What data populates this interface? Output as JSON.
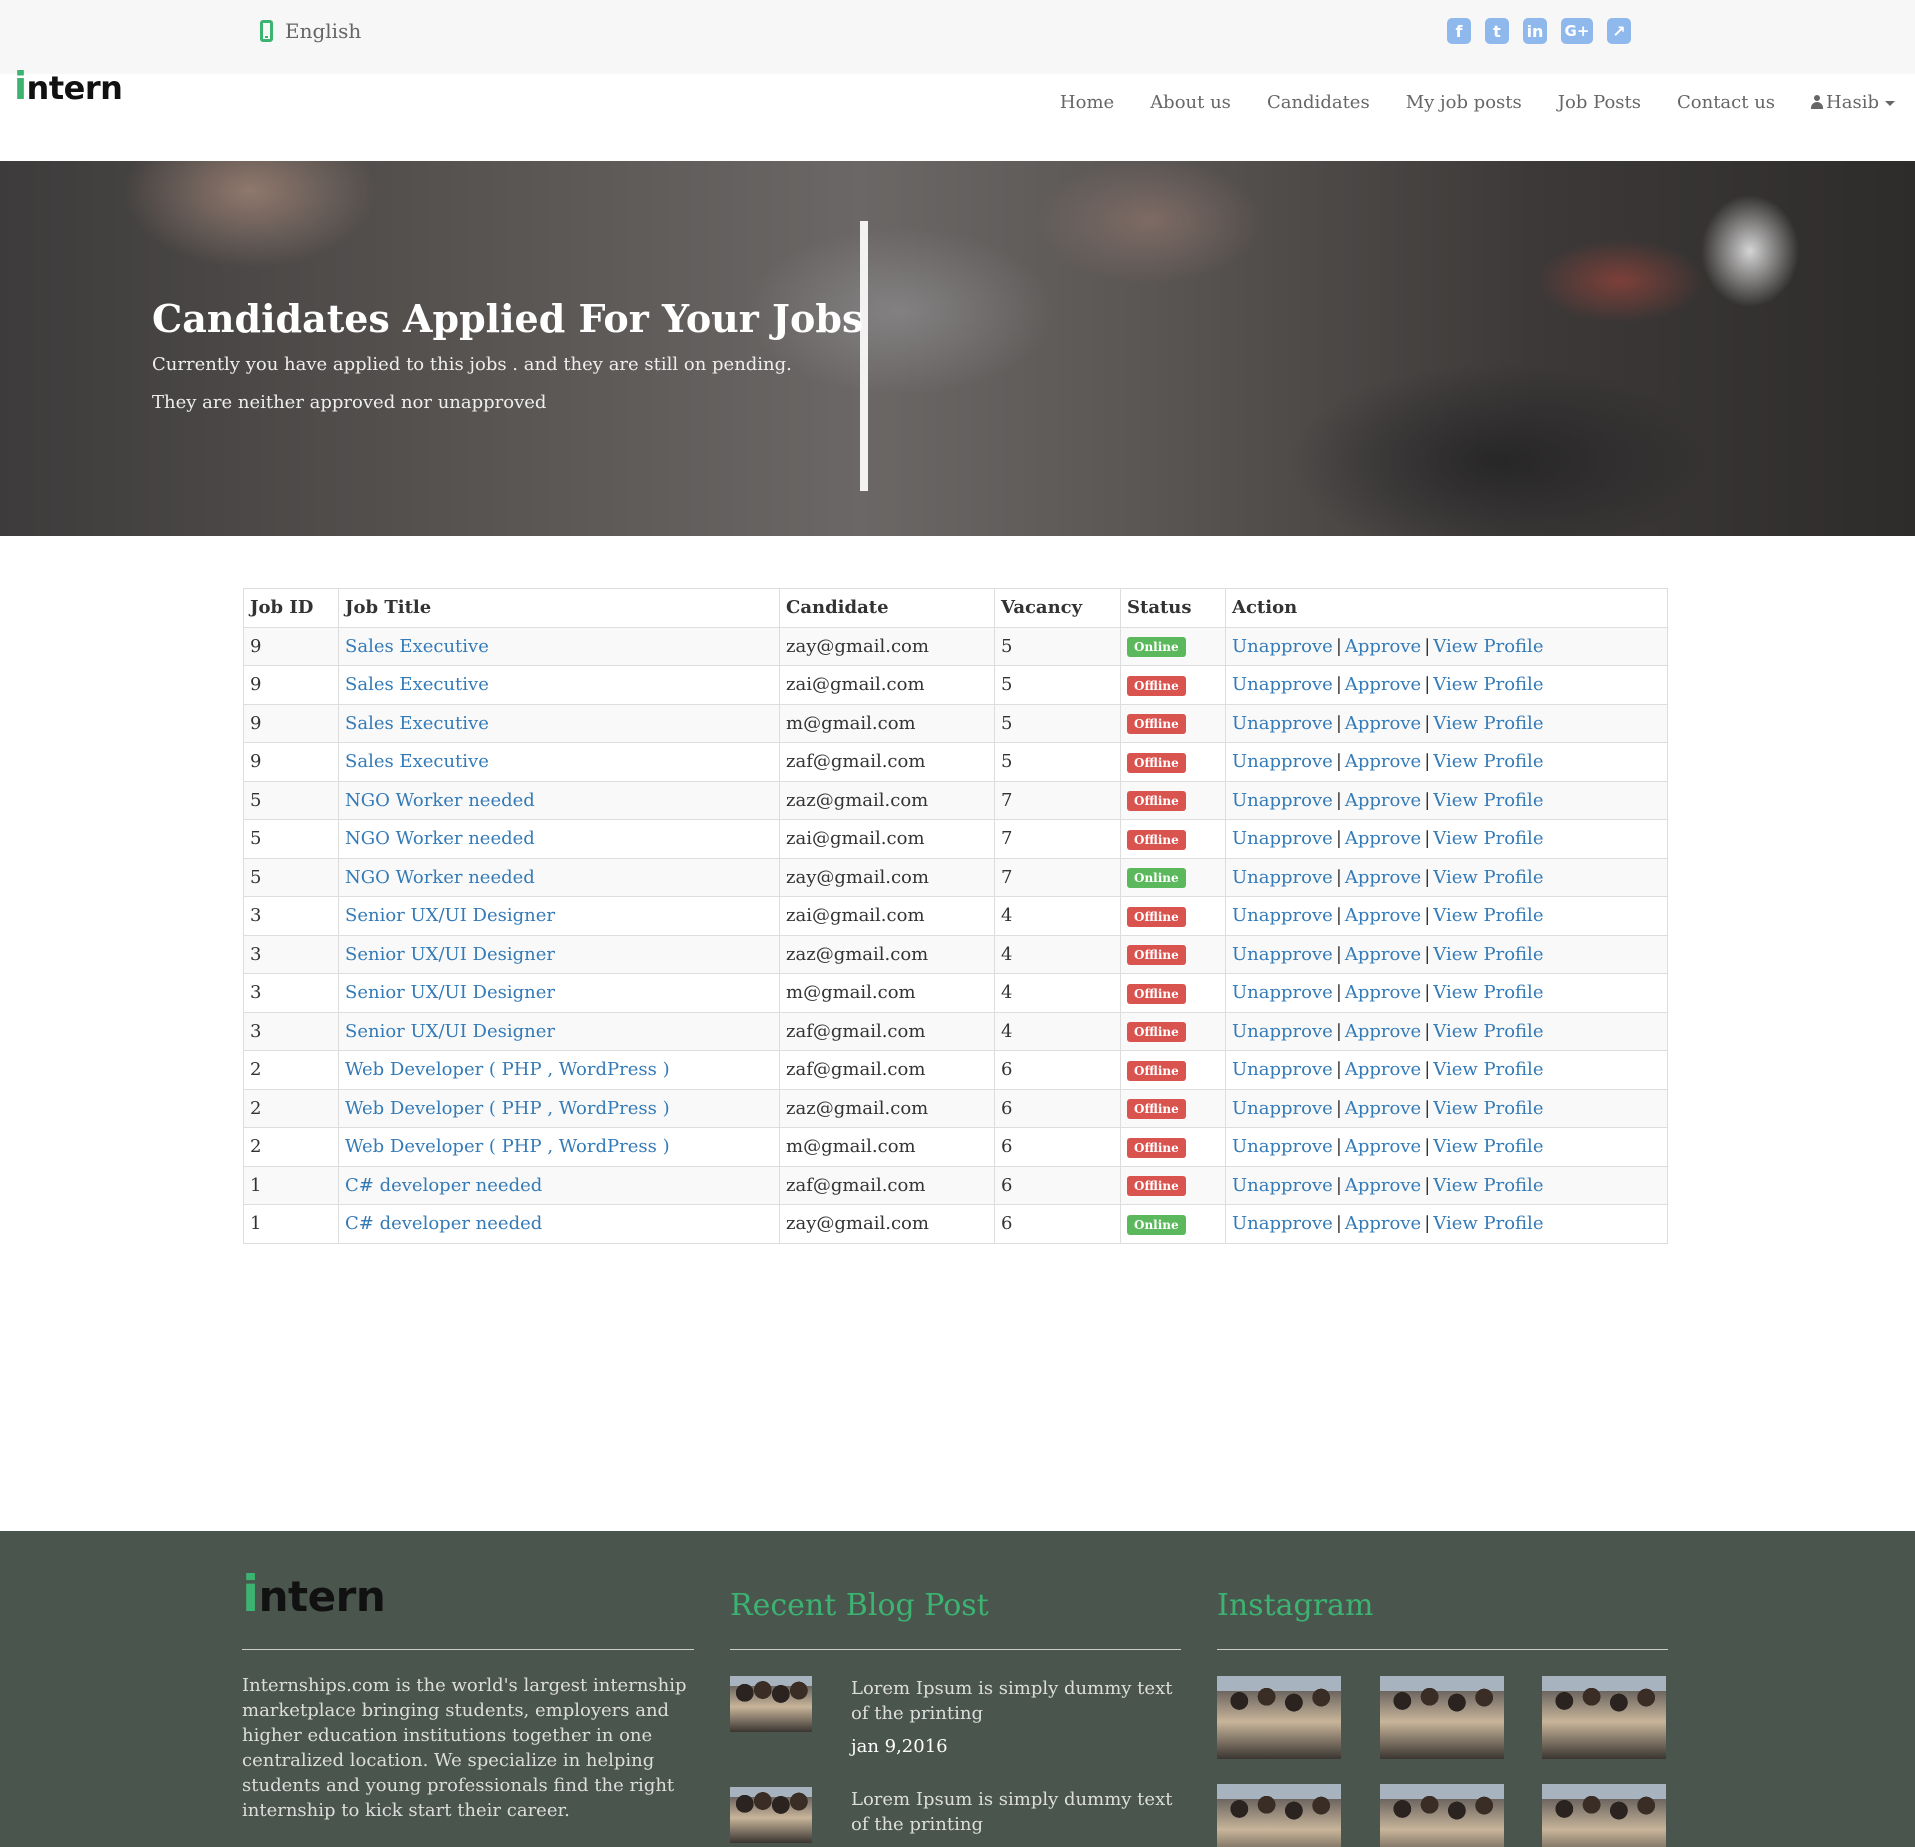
{
  "topbar": {
    "language": "English",
    "social_icons": [
      "facebook-icon",
      "twitter-icon",
      "linkedin-icon",
      "google-plus-icon",
      "share-icon"
    ],
    "social_glyphs": [
      "f",
      "t",
      "in",
      "G+",
      "↗"
    ]
  },
  "brand": {
    "logo_i": "i",
    "logo_rest": "ntern"
  },
  "nav": {
    "items": [
      "Home",
      "About us",
      "Candidates",
      "My job posts",
      "Job Posts",
      "Contact us"
    ],
    "user": "Hasib"
  },
  "hero": {
    "title": "Candidates Applied For Your Jobs",
    "subtitle1": "Currently you have applied to this jobs . and they are still on pending.",
    "subtitle2": "They are neither approved nor unapproved"
  },
  "table": {
    "headers": [
      "Job ID",
      "Job Title",
      "Candidate",
      "Vacancy",
      "Status",
      "Action"
    ],
    "actions": [
      "Unapprove",
      "Approve",
      "View Profile"
    ],
    "separator": "|",
    "rows": [
      {
        "id": "9",
        "title": "Sales Executive",
        "candidate": "zay@gmail.com",
        "vacancy": "5",
        "status": "Online"
      },
      {
        "id": "9",
        "title": "Sales Executive",
        "candidate": "zai@gmail.com",
        "vacancy": "5",
        "status": "Offline"
      },
      {
        "id": "9",
        "title": "Sales Executive",
        "candidate": "m@gmail.com",
        "vacancy": "5",
        "status": "Offline"
      },
      {
        "id": "9",
        "title": "Sales Executive",
        "candidate": "zaf@gmail.com",
        "vacancy": "5",
        "status": "Offline"
      },
      {
        "id": "5",
        "title": "NGO Worker needed",
        "candidate": "zaz@gmail.com",
        "vacancy": "7",
        "status": "Offline"
      },
      {
        "id": "5",
        "title": "NGO Worker needed",
        "candidate": "zai@gmail.com",
        "vacancy": "7",
        "status": "Offline"
      },
      {
        "id": "5",
        "title": "NGO Worker needed",
        "candidate": "zay@gmail.com",
        "vacancy": "7",
        "status": "Online"
      },
      {
        "id": "3",
        "title": "Senior UX/UI Designer",
        "candidate": "zai@gmail.com",
        "vacancy": "4",
        "status": "Offline"
      },
      {
        "id": "3",
        "title": "Senior UX/UI Designer",
        "candidate": "zaz@gmail.com",
        "vacancy": "4",
        "status": "Offline"
      },
      {
        "id": "3",
        "title": "Senior UX/UI Designer",
        "candidate": "m@gmail.com",
        "vacancy": "4",
        "status": "Offline"
      },
      {
        "id": "3",
        "title": "Senior UX/UI Designer",
        "candidate": "zaf@gmail.com",
        "vacancy": "4",
        "status": "Offline"
      },
      {
        "id": "2",
        "title": "Web Developer ( PHP , WordPress )",
        "candidate": "zaf@gmail.com",
        "vacancy": "6",
        "status": "Offline"
      },
      {
        "id": "2",
        "title": "Web Developer ( PHP , WordPress )",
        "candidate": "zaz@gmail.com",
        "vacancy": "6",
        "status": "Offline"
      },
      {
        "id": "2",
        "title": "Web Developer ( PHP , WordPress )",
        "candidate": "m@gmail.com",
        "vacancy": "6",
        "status": "Offline"
      },
      {
        "id": "1",
        "title": "C# developer needed",
        "candidate": "zaf@gmail.com",
        "vacancy": "6",
        "status": "Offline"
      },
      {
        "id": "1",
        "title": "C# developer needed",
        "candidate": "zay@gmail.com",
        "vacancy": "6",
        "status": "Online"
      }
    ]
  },
  "footer": {
    "about": "Internships.com is the world's largest internship marketplace bringing students, employers and higher education institutions together in one centralized location. We specialize in helping students and young professionals find the right internship to kick start their career.",
    "blog_heading": "Recent Blog Post",
    "instagram_heading": "Instagram",
    "posts": [
      {
        "title": "Lorem Ipsum is simply dummy text of the printing",
        "date": "jan 9,2016"
      },
      {
        "title": "Lorem Ipsum is simply dummy text of the printing",
        "date": ""
      }
    ]
  },
  "colors": {
    "brand_green": "#3cb371",
    "link_blue": "#337ab7",
    "online": "#5cb85c",
    "offline": "#d9534f",
    "footer_bg": "#4a554d"
  }
}
